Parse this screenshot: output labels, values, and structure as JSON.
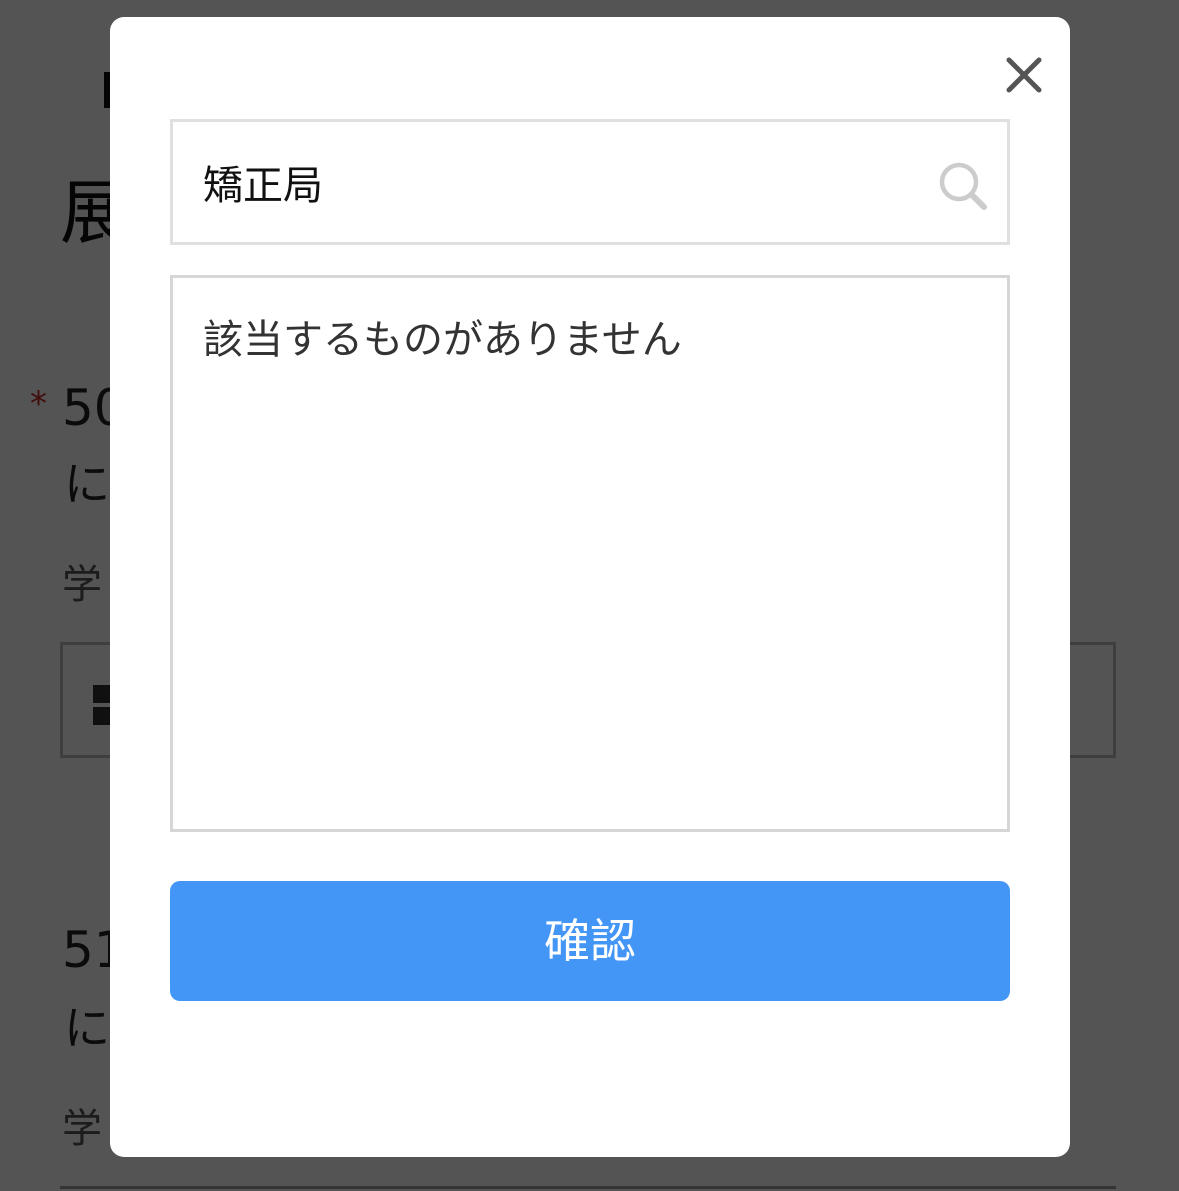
{
  "background": {
    "title": "展",
    "required_mark": "*",
    "question_1": {
      "number": "50",
      "text": "に",
      "label": "学"
    },
    "question_2": {
      "number": "51",
      "text": "に",
      "label": "学"
    }
  },
  "modal": {
    "close_icon": "close-icon",
    "search": {
      "value": "矯正局",
      "icon": "search-icon"
    },
    "empty_message": "該当するものがありません",
    "confirm_label": "確認"
  },
  "colors": {
    "overlay": "#000000aa",
    "accent": "#4496f6",
    "required": "#c62828"
  }
}
